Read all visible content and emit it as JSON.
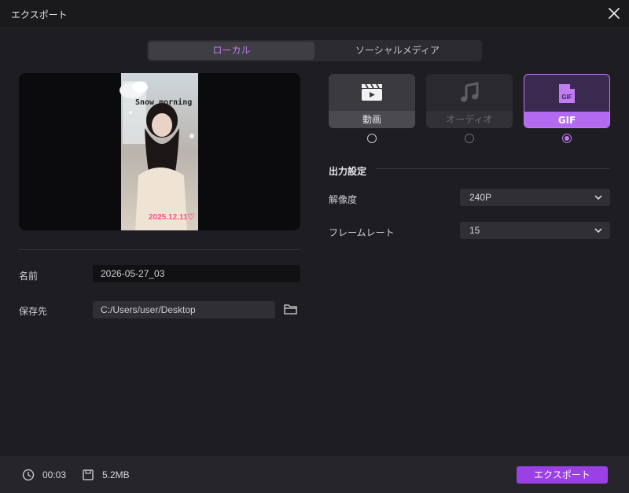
{
  "window": {
    "title": "エクスポート"
  },
  "tabs": {
    "local": "ローカル",
    "social": "ソーシャルメディア"
  },
  "preview": {
    "overlay_text": "Snow morning",
    "date_text": "2025.12.11♡"
  },
  "fields": {
    "name_label": "名前",
    "name_value": "2026-05-27_03",
    "save_label": "保存先",
    "save_value": "C:/Users/user/Desktop"
  },
  "formats": [
    {
      "label": "動画",
      "icon": "clapperboard-icon",
      "selected": false
    },
    {
      "label": "オーディオ",
      "icon": "music-note-icon",
      "selected": false
    },
    {
      "label": "GIF",
      "icon": "gif-file-icon",
      "selected": true
    }
  ],
  "output": {
    "title": "出力設定",
    "resolution_label": "解像度",
    "resolution_value": "240P",
    "framerate_label": "フレームレート",
    "framerate_value": "15"
  },
  "footer": {
    "duration": "00:03",
    "size": "5.2MB",
    "export_label": "エクスポート"
  },
  "colors": {
    "accent": "#c07cf0",
    "export": "#9b3fe6"
  }
}
